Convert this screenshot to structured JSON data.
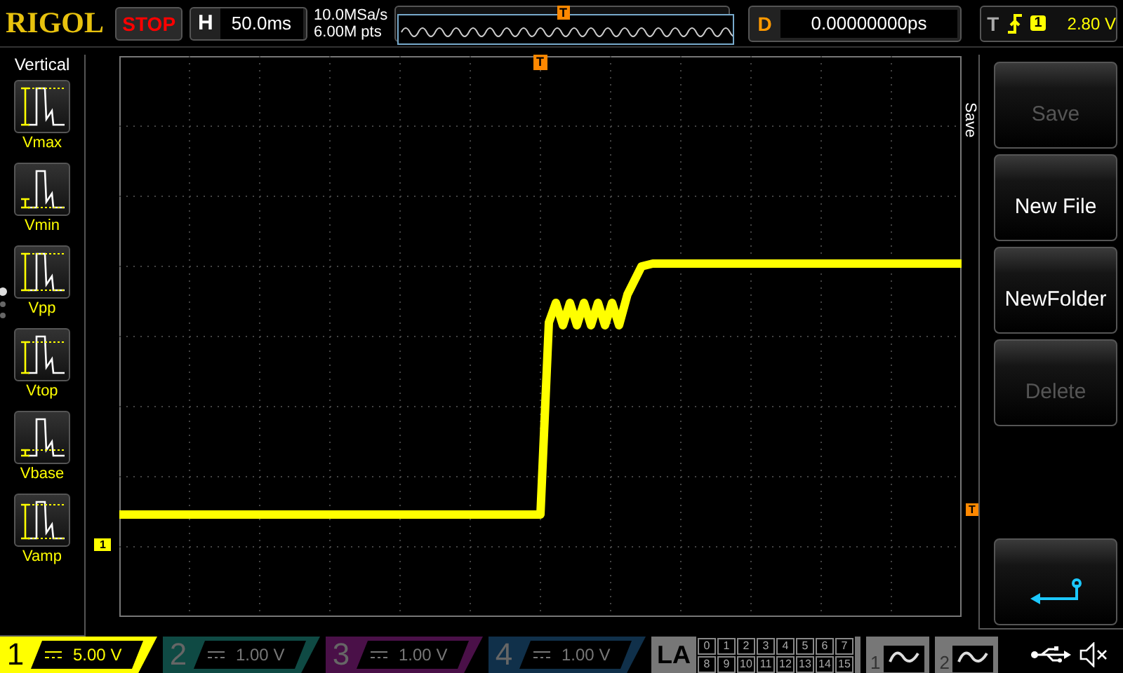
{
  "top_bar": {
    "logo": "RIGOL",
    "run_state": "STOP",
    "horizontal": {
      "label": "H",
      "value": "50.0ms"
    },
    "sample_rate": "10.0MSa/s",
    "memory_depth": "6.00M pts",
    "overview_marker": "T",
    "delay": {
      "label": "D",
      "value": "0.00000000ps"
    },
    "trigger": {
      "label": "T",
      "source": "1",
      "level": "2.80 V"
    }
  },
  "left_panel": {
    "title": "Vertical",
    "page_dots": [
      {
        "selected": true
      },
      {
        "selected": false
      },
      {
        "selected": false
      }
    ],
    "items": [
      {
        "label": "Vmax",
        "kind": "max"
      },
      {
        "label": "Vmin",
        "kind": "min"
      },
      {
        "label": "Vpp",
        "kind": "pp"
      },
      {
        "label": "Vtop",
        "kind": "top"
      },
      {
        "label": "Vbase",
        "kind": "base"
      },
      {
        "label": "Vamp",
        "kind": "amp"
      }
    ]
  },
  "screen": {
    "trigger_position_marker": "T",
    "trigger_level_marker": "T",
    "channel_marker": "1"
  },
  "right_menu": {
    "title": "Save",
    "items": [
      {
        "kind": "text",
        "label": "Save",
        "disabled": true
      },
      {
        "kind": "text",
        "label": "New File",
        "disabled": false
      },
      {
        "kind": "text",
        "label": "NewFolder",
        "disabled": false
      },
      {
        "kind": "text",
        "label": "Delete",
        "disabled": true
      },
      {
        "kind": "back"
      }
    ]
  },
  "bottom_bar": {
    "channels": [
      {
        "number": "1",
        "scale": "5.00 V",
        "active": true,
        "color": "#ffff00"
      },
      {
        "number": "2",
        "scale": "1.00 V",
        "active": false,
        "color": "#0f4a44"
      },
      {
        "number": "3",
        "scale": "1.00 V",
        "active": false,
        "color": "#4a1048"
      },
      {
        "number": "4",
        "scale": "1.00 V",
        "active": false,
        "color": "#10304a"
      }
    ],
    "la": {
      "label": "LA",
      "channels": [
        "0",
        "1",
        "2",
        "3",
        "4",
        "5",
        "6",
        "7",
        "8",
        "9",
        "10",
        "11",
        "12",
        "13",
        "14",
        "15"
      ]
    },
    "generators": [
      {
        "number": "1"
      },
      {
        "number": "2"
      }
    ]
  }
}
